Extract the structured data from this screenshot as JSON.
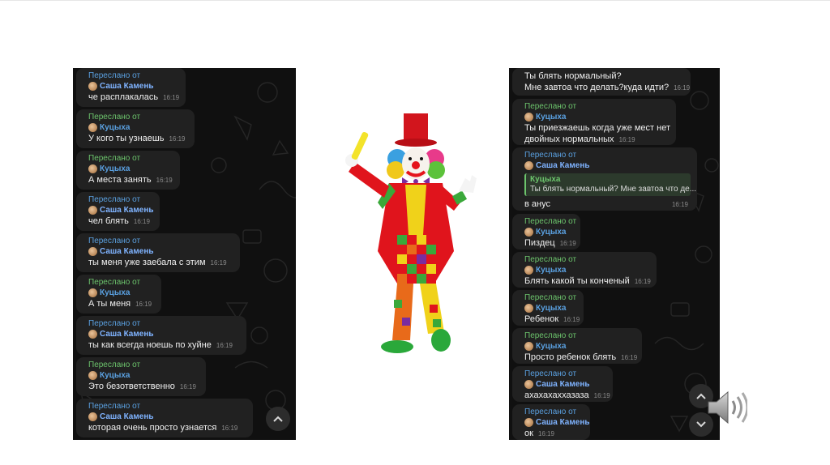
{
  "left_chat": {
    "messages": [
      {
        "forwarded_label": "Переслано от",
        "sender": "Саша Камень",
        "text": "че расплакалась",
        "time": "16:19"
      },
      {
        "forwarded_label": "Переслано от",
        "sender": "Куцыха",
        "text": "У кого ты узнаешь",
        "time": "16:19"
      },
      {
        "forwarded_label": "Переслано от",
        "sender": "Куцыха",
        "text": "А места занять",
        "time": "16:19"
      },
      {
        "forwarded_label": "Переслано от",
        "sender": "Саша Камень",
        "text": "чел блять",
        "time": "16:19"
      },
      {
        "forwarded_label": "Переслано от",
        "sender": "Саша Камень",
        "text": "ты меня уже заебала с этим",
        "time": "16:19"
      },
      {
        "forwarded_label": "Переслано от",
        "sender": "Куцыха",
        "text": "А ты меня",
        "time": "16:19"
      },
      {
        "forwarded_label": "Переслано от",
        "sender": "Саша Камень",
        "text": "ты как всегда ноешь по хуйне",
        "time": "16:19"
      },
      {
        "forwarded_label": "Переслано от",
        "sender": "Куцыха",
        "text": "Это безответственно",
        "time": "16:19"
      },
      {
        "forwarded_label": "Переслано от",
        "sender": "Саша Камень",
        "text": "которая очень просто узнается",
        "time": "16:19"
      }
    ]
  },
  "right_chat": {
    "top_message": {
      "line1": "Ты блять нормальный?",
      "line2": "Мне завтоа что делать?куда идти?",
      "time": "16:19"
    },
    "messages": [
      {
        "forwarded_label": "Переслано от",
        "sender": "Куцыха",
        "line1": "Ты приезжаешь когда уже мест нет",
        "line2": "двойных нормальных",
        "time": "16:19"
      },
      {
        "forwarded_label": "Переслано от",
        "sender": "Саша Камень",
        "quote_name": "Куцыха",
        "quote_text": "Ты блять нормальный? Мне завтоа что де...",
        "text": "в анус",
        "time": "16:19"
      },
      {
        "forwarded_label": "Переслано от",
        "sender": "Куцыха",
        "text": "Пиздец",
        "time": "16:19"
      },
      {
        "forwarded_label": "Переслано от",
        "sender": "Куцыха",
        "text": "Блять какой ты конченый",
        "time": "16:19"
      },
      {
        "forwarded_label": "Переслано от",
        "sender": "Куцыха",
        "text": "Ребенок",
        "time": "16:19"
      },
      {
        "forwarded_label": "Переслано от",
        "sender": "Куцыха",
        "text": "Просто ребенок блять",
        "time": "16:19"
      },
      {
        "forwarded_label": "Переслано от",
        "sender": "Саша Камень",
        "text": "ахахахаххазаза",
        "time": "16:19"
      },
      {
        "forwarded_label": "Переслано от",
        "sender": "Саша Камень",
        "text": "ок",
        "time": "16:19"
      }
    ]
  },
  "icons": {
    "scroll_up": "chevron-up-icon",
    "scroll_down": "chevron-down-icon",
    "speaker": "speaker-icon",
    "clown": "clown-illustration"
  },
  "colors": {
    "chat_bg": "#101010",
    "bubble_bg": "#212121",
    "forward_label": "#5aa0e0",
    "quote_accent": "#6cc46c"
  }
}
